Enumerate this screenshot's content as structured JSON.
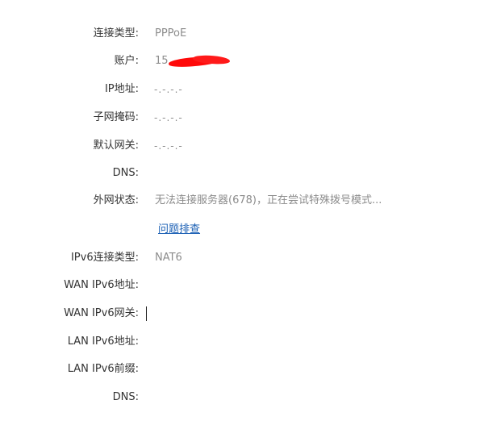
{
  "connection": {
    "type_label": "连接类型:",
    "type_value": "PPPoE",
    "account_label": "账户:",
    "account_value_visible": "15",
    "ip_label": "IP地址:",
    "ip_value": "-.-.-.-",
    "mask_label": "子网掩码:",
    "mask_value": "-.-.-.-",
    "gateway_label": "默认网关:",
    "gateway_value": "-.-.-.-",
    "dns_label": "DNS:",
    "wan_status_label": "外网状态:",
    "wan_status_value": "无法连接服务器(678)，正在尝试特殊拨号模式...",
    "troubleshoot_link": "问题排查"
  },
  "ipv6": {
    "type_label": "IPv6连接类型:",
    "type_value": "NAT6",
    "wan_addr_label": "WAN IPv6地址:",
    "wan_gateway_label": "WAN IPv6网关:",
    "lan_addr_label": "LAN IPv6地址:",
    "lan_prefix_label": "LAN IPv6前缀:",
    "dns_label": "DNS:"
  },
  "colors": {
    "label": "#333333",
    "value": "#8c8c8c",
    "link": "#1a5fb4",
    "redaction": "#ff0a0a"
  }
}
